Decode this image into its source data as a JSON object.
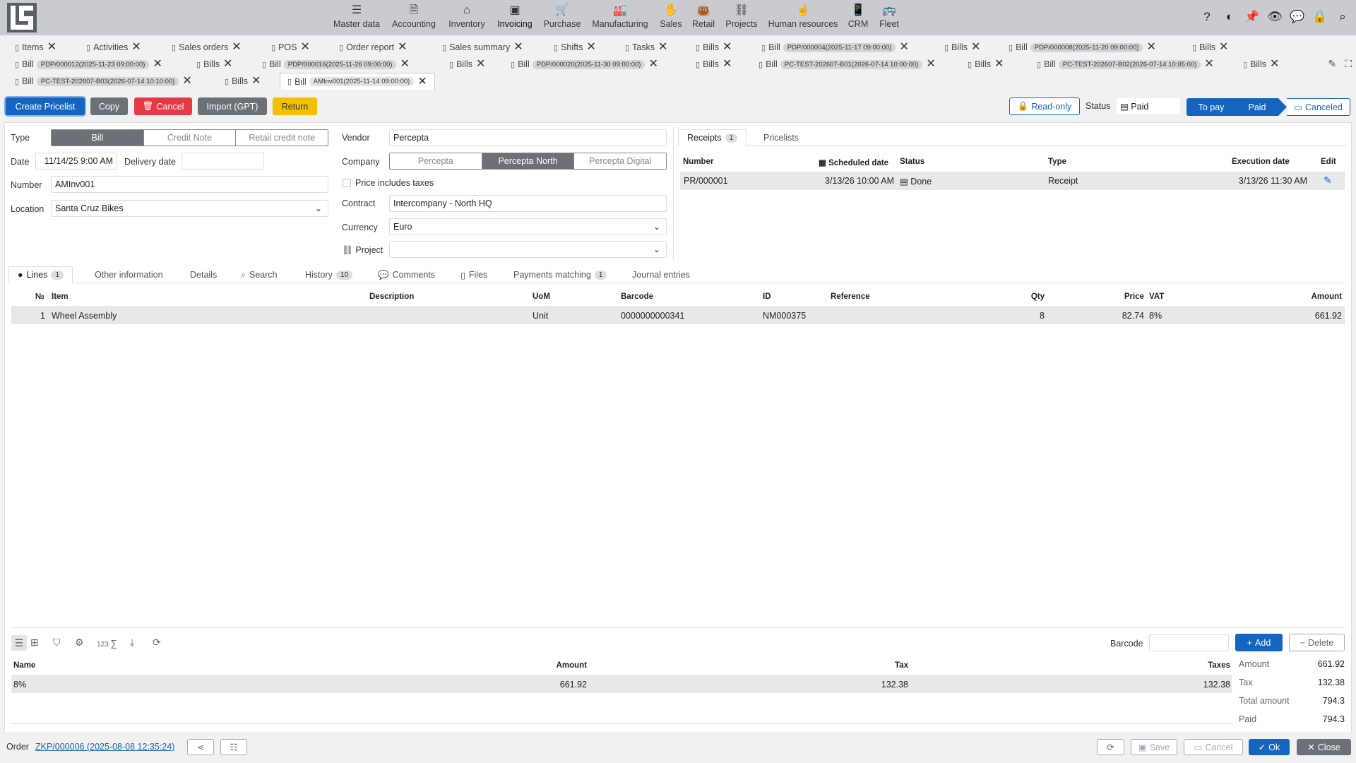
{
  "colors": {
    "accent": "#1565c0",
    "danger": "#e53945",
    "warning": "#f5c000",
    "muted": "#6b7177"
  },
  "modules": [
    {
      "label": "Master data",
      "icon": "list-check-icon"
    },
    {
      "label": "Accounting",
      "icon": "ledger-icon"
    },
    {
      "label": "Inventory",
      "icon": "warehouse-icon"
    },
    {
      "label": "Invoicing",
      "icon": "cash-icon"
    },
    {
      "label": "Purchase",
      "icon": "cart-icon"
    },
    {
      "label": "Manufacturing",
      "icon": "factory-icon"
    },
    {
      "label": "Sales",
      "icon": "hand-coin-icon"
    },
    {
      "label": "Retail",
      "icon": "shopping-bag-icon"
    },
    {
      "label": "Projects",
      "icon": "project-diagram-icon"
    },
    {
      "label": "Human resources",
      "icon": "fingerprint-icon"
    },
    {
      "label": "CRM",
      "icon": "phone-icon"
    },
    {
      "label": "Fleet",
      "icon": "bus-icon"
    }
  ],
  "tabs_row1": [
    {
      "label": "Items"
    },
    {
      "label": "Activities"
    },
    {
      "label": "Sales orders"
    },
    {
      "label": "POS"
    },
    {
      "label": "Order report"
    },
    {
      "label": "Sales summary"
    },
    {
      "label": "Shifts"
    },
    {
      "label": "Tasks"
    },
    {
      "label": "Bills"
    },
    {
      "label": "Bill",
      "pill": "PDP/000004(2025-11-17 09:00:00)"
    },
    {
      "label": "Bills"
    },
    {
      "label": "Bill",
      "pill": "PDP/000008(2025-11-20 09:00:00)"
    },
    {
      "label": "Bills"
    }
  ],
  "tabs_row2": [
    {
      "label": "Bill",
      "pill": "PDP/000012(2025-11-23 09:00:00)"
    },
    {
      "label": "Bills"
    },
    {
      "label": "Bill",
      "pill": "PDP/000016(2025-11-26 09:00:00)"
    },
    {
      "label": "Bills"
    },
    {
      "label": "Bill",
      "pill": "PDP/000020(2025-11-30 09:00:00)"
    },
    {
      "label": "Bills"
    },
    {
      "label": "Bill",
      "pill": "PC-TEST-202607-B01(2026-07-14 10:00:00)"
    },
    {
      "label": "Bills"
    },
    {
      "label": "Bill",
      "pill": "PC-TEST-202607-B02(2026-07-14 10:05:00)"
    },
    {
      "label": "Bills"
    }
  ],
  "tabs_row3": [
    {
      "label": "Bill",
      "pill": "PC-TEST-202607-B03(2026-07-14 10:10:00)"
    },
    {
      "label": "Bills"
    },
    {
      "label": "Bill",
      "pill": "AMInv001(2025-11-14 09:00:00)"
    }
  ],
  "toolbar": {
    "create_pricelist": "Create Pricelist",
    "copy": "Copy",
    "cancel": "Cancel",
    "import": "Import (GPT)",
    "return": "Return",
    "readonly": "Read-only",
    "status_label": "Status",
    "status_value": "Paid",
    "to_pay": "To pay",
    "paid": "Paid",
    "canceled": "Canceled"
  },
  "form": {
    "type_label": "Type",
    "type_options": [
      "Bill",
      "Credit Note",
      "Retail credit note"
    ],
    "date_label": "Date",
    "date_value": "11/14/25 9:00 AM",
    "delivery_label": "Delivery date",
    "delivery_value": "",
    "number_label": "Number",
    "number_value": "AMInv001",
    "location_label": "Location",
    "location_value": "Santa Cruz Bikes",
    "vendor_label": "Vendor",
    "vendor_value": "Percepta",
    "company_label": "Company",
    "company_options": [
      "Percepta",
      "Percepta North",
      "Percepta Digital"
    ],
    "price_taxes_label": "Price includes taxes",
    "price_taxes_checked": false,
    "contract_label": "Contract",
    "contract_value": "Intercompany - North HQ",
    "currency_label": "Currency",
    "currency_value": "Euro",
    "project_label": "Project",
    "project_value": ""
  },
  "receipts": {
    "tabs": [
      {
        "label": "Receipts",
        "count": "1"
      },
      {
        "label": "Pricelists"
      }
    ],
    "headers": {
      "number": "Number",
      "scheduled": "Scheduled date",
      "status": "Status",
      "type": "Type",
      "execution": "Execution date",
      "edit": "Edit"
    },
    "rows": [
      {
        "number": "PR/000001",
        "scheduled": "3/13/26 10:00 AM",
        "status": "Done",
        "type": "Receipt",
        "execution": "3/13/26 11:30 AM"
      }
    ]
  },
  "doc_tabs": [
    {
      "label": "Lines",
      "count": "1"
    },
    {
      "label": "Other information"
    },
    {
      "label": "Details"
    },
    {
      "label": "Search"
    },
    {
      "label": "History",
      "count": "10"
    },
    {
      "label": "Comments"
    },
    {
      "label": "Files"
    },
    {
      "label": "Payments matching",
      "count": "1"
    },
    {
      "label": "Journal entries"
    }
  ],
  "lines": {
    "headers": {
      "no": "№",
      "item": "Item",
      "description": "Description",
      "uom": "UoM",
      "barcode": "Barcode",
      "id": "ID",
      "reference": "Reference",
      "qty": "Qty",
      "price": "Price",
      "vat": "VAT",
      "amount": "Amount"
    },
    "rows": [
      {
        "no": "1",
        "item": "Wheel Assembly",
        "description": "",
        "uom": "Unit",
        "barcode": "0000000000341",
        "id": "NM000375",
        "reference": "",
        "qty": "8",
        "price": "82.74",
        "vat": "8%",
        "amount": "661.92"
      }
    ]
  },
  "lines_footer": {
    "count_label": "123",
    "barcode_label": "Barcode",
    "barcode_value": "",
    "add": "Add",
    "delete": "Delete"
  },
  "taxes": {
    "headers": {
      "name": "Name",
      "amount": "Amount",
      "tax": "Tax",
      "taxes": "Taxes"
    },
    "rows": [
      {
        "name": "8%",
        "amount": "661.92",
        "tax": "132.38",
        "taxes": "132.38"
      }
    ]
  },
  "totals": [
    {
      "label": "Amount",
      "value": "661.92"
    },
    {
      "label": "Tax",
      "value": "132.38"
    },
    {
      "label": "Total amount",
      "value": "794.3"
    },
    {
      "label": "Paid",
      "value": "794.3"
    }
  ],
  "status_bar": {
    "order_label": "Order",
    "order_link": "ZKP/000006 (2025-08-08 12:35:24)",
    "save": "Save",
    "cancel": "Cancel",
    "ok": "Ok",
    "close": "Close"
  }
}
